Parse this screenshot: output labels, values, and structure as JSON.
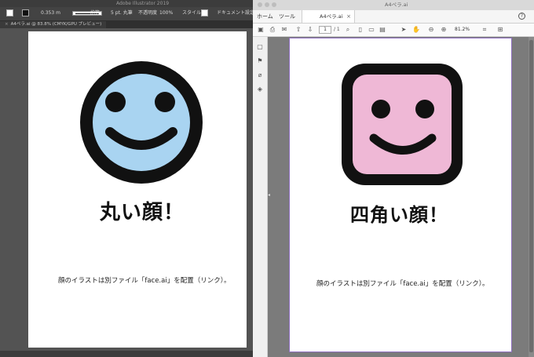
{
  "illustrator": {
    "app_title": "Adobe Illustrator 2019",
    "control_bar": {
      "stroke_weight": "0.353 m",
      "profile": "均等",
      "brush": "5 pt. 丸筆",
      "opacity_label": "不透明度",
      "opacity_value": "100%",
      "style_label": "スタイル",
      "doc_setup_button": "ドキュメント設定"
    },
    "document_tab": "A4ペラ.ai @ 83.8% (CMYK/GPU プレビュー)",
    "artwork": {
      "face_shape": "round",
      "face_color": "#a9d4f1",
      "heading": "丸い顔！",
      "caption": "顔のイラストは別ファイル「face.ai」を配置（リンク）。"
    }
  },
  "acrobat": {
    "window_title": "A4ペラ.ai",
    "nav": {
      "home": "ホーム",
      "tools": "ツール"
    },
    "document_tab": "A4ペラ.ai",
    "toolbar": {
      "page_current": "1",
      "page_total": "/ 1",
      "zoom": "81.2%"
    },
    "artwork": {
      "face_shape": "rounded-square",
      "face_color": "#efb8d6",
      "heading": "四角い顔！",
      "caption": "顔のイラストは別ファイル「face.ai」を配置（リンク）。"
    }
  },
  "colors": {
    "illustrator_bg": "#535353",
    "acrobat_canvas": "#7b7b7b",
    "page_border": "#8f6fc0",
    "face_outline": "#111111"
  },
  "icons": [
    "save-icon",
    "print-icon",
    "email-icon",
    "search-icon",
    "page-up-icon",
    "page-down-icon",
    "select-cursor-icon",
    "hand-icon",
    "zoom-out-icon",
    "zoom-in-icon",
    "help-icon",
    "bookmark-icon",
    "attachment-icon",
    "layers-icon",
    "pages-icon"
  ]
}
